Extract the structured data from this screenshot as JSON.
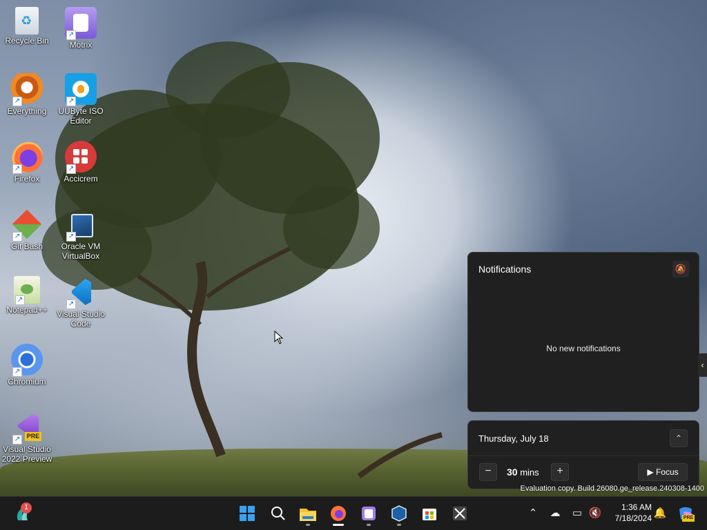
{
  "desktop": {
    "icons": [
      {
        "label": "Recycle Bin",
        "icon": "recycle-bin-icon"
      },
      {
        "label": "Motrix",
        "icon": "motrix-icon"
      },
      {
        "label": "Everything",
        "icon": "everything-icon"
      },
      {
        "label": "UUByte ISO Editor",
        "icon": "uubyte-iso-editor-icon"
      },
      {
        "label": "Firefox",
        "icon": "firefox-icon"
      },
      {
        "label": "Accicrem",
        "icon": "accicrem-icon"
      },
      {
        "label": "Git Bash",
        "icon": "git-bash-icon"
      },
      {
        "label": "Oracle VM VirtualBox",
        "icon": "virtualbox-icon"
      },
      {
        "label": "Notepad++",
        "icon": "notepad-plus-plus-icon"
      },
      {
        "label": "Visual Studio Code",
        "icon": "vscode-icon"
      },
      {
        "label": "Chromium",
        "icon": "chromium-icon"
      },
      {
        "label": "Visual Studio 2022 Preview",
        "icon": "visual-studio-preview-icon"
      }
    ],
    "watermark": "Evaluation copy. Build 26080.ge_release.240308-1400"
  },
  "notifications": {
    "title": "Notifications",
    "empty_text": "No new notifications"
  },
  "calendar": {
    "date": "Thursday, July 18",
    "focus_minutes": "30",
    "minutes_unit": "mins",
    "focus_label": "Focus"
  },
  "taskbar": {
    "weather_badge": "1",
    "pinned": [
      "start-button",
      "search-button",
      "file-explorer",
      "firefox",
      "motrix",
      "virtualbox",
      "microsoft-store",
      "snipping-tool"
    ],
    "clock_time": "1:36 AM",
    "clock_date": "7/18/2024",
    "copilot_badge": "PRE"
  },
  "colors": {
    "panel_bg": "#202020",
    "taskbar_bg": "#1c1c1c",
    "accent": "#0078d4"
  }
}
